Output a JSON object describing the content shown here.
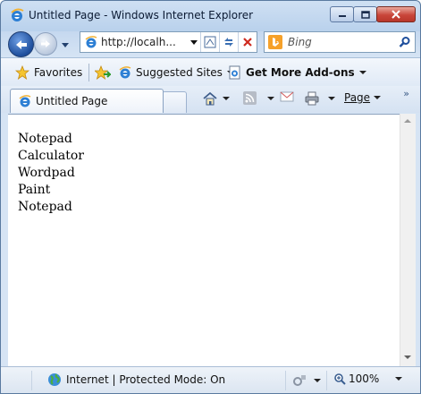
{
  "window": {
    "title": "Untitled Page - Windows Internet Explorer",
    "buttons": {
      "minimize": "minimize",
      "maximize": "maximize",
      "close": "close"
    }
  },
  "address_bar": {
    "url": "http://localh...",
    "search_placeholder": "Bing"
  },
  "favorites_bar": {
    "favorites_label": "Favorites",
    "suggested_sites_label": "Suggested Sites",
    "addons_label": "Get More Add-ons"
  },
  "tab": {
    "label": "Untitled Page"
  },
  "command_bar": {
    "page_label": "Page"
  },
  "content": {
    "items": [
      "Notepad",
      "Calculator",
      "Wordpad",
      "Paint",
      "Notepad"
    ]
  },
  "status_bar": {
    "zone_text": "Internet | Protected Mode: On",
    "zoom": "100%"
  },
  "colors": {
    "accent": "#1e4e9c",
    "close_button": "#c9463a",
    "bing": "#f6a12a"
  }
}
